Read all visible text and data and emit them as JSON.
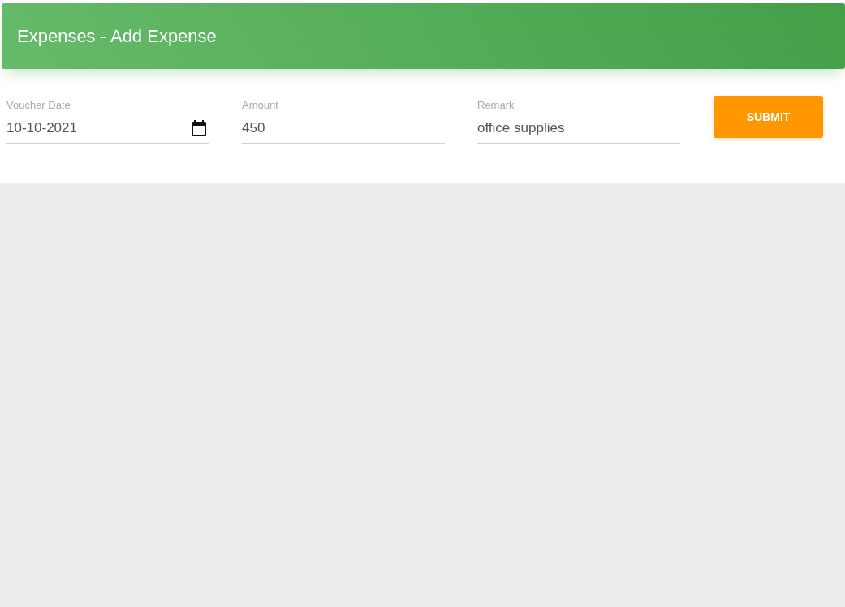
{
  "header": {
    "title": "Expenses - Add Expense"
  },
  "fields": [
    {
      "kind": "date",
      "label": "Voucher Date",
      "value": "10-10-2021"
    },
    {
      "kind": "text",
      "label": "Amount",
      "value": "450"
    },
    {
      "kind": "text",
      "label": "Remark",
      "value": "office supplies"
    }
  ],
  "submit_button": {
    "label": "SUBMIT"
  }
}
